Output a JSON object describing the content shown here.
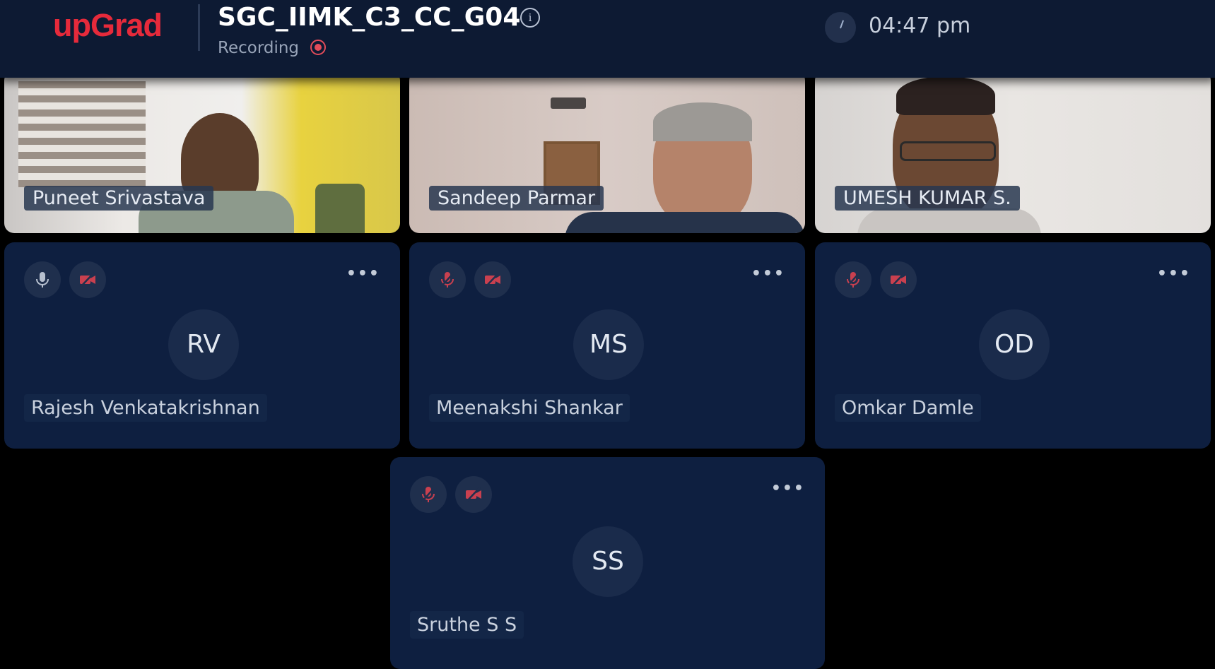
{
  "header": {
    "brand_up": "up",
    "brand_grad": "Grad",
    "meeting_title": "SGC_IIMK_C3_CC_G04",
    "recording_label": "Recording",
    "time": "04:47 pm"
  },
  "colors": {
    "brand_red": "#e62a3b",
    "header_bg": "#0d1a33",
    "tile_bg": "#0e1f40",
    "muted_red": "#c9404f"
  },
  "video_participants": [
    {
      "name": "Puneet Srivastava"
    },
    {
      "name": "Sandeep Parmar"
    },
    {
      "name": "UMESH KUMAR S."
    }
  ],
  "avatar_participants": [
    {
      "initials": "RV",
      "name": "Rajesh Venkatakrishnan",
      "mic": "mic-on-icon",
      "camera": "camera-off-icon"
    },
    {
      "initials": "MS",
      "name": "Meenakshi Shankar",
      "mic": "mic-off-icon",
      "camera": "camera-off-icon"
    },
    {
      "initials": "OD",
      "name": "Omkar Damle",
      "mic": "mic-off-icon",
      "camera": "camera-off-icon"
    },
    {
      "initials": "SS",
      "name": "Sruthe S S",
      "mic": "mic-off-icon",
      "camera": "camera-off-icon"
    }
  ],
  "more_label": "•••"
}
